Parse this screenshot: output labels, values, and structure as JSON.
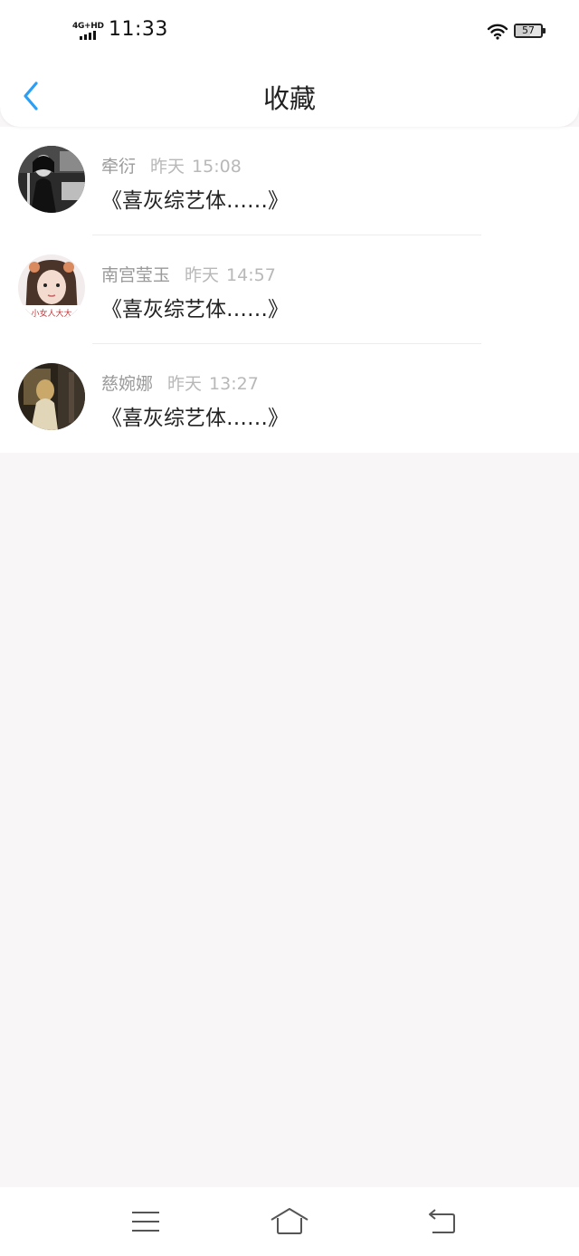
{
  "status_bar": {
    "network": "4G+HD",
    "time": "11:33",
    "battery": "57",
    "battery_level": 0.57
  },
  "header": {
    "title": "收藏",
    "back_icon": "chevron-left-icon",
    "accent_color": "#2a9ff5"
  },
  "favorites": [
    {
      "author": "牵衍",
      "date": "昨天",
      "time": "15:08",
      "content": "《喜灰综艺体……》",
      "avatar": "avatar-1"
    },
    {
      "author": "南宫莹玉",
      "date": "昨天",
      "time": "14:57",
      "content": "《喜灰综艺体……》",
      "avatar": "avatar-2"
    },
    {
      "author": "慈婉娜",
      "date": "昨天",
      "time": "13:27",
      "content": "《喜灰综艺体……》",
      "avatar": "avatar-3"
    }
  ],
  "avatar_2_caption": "小女人大大",
  "system_nav": {
    "menu_icon": "menu-icon",
    "home_icon": "home-icon",
    "back_icon": "back-arrow-icon"
  }
}
